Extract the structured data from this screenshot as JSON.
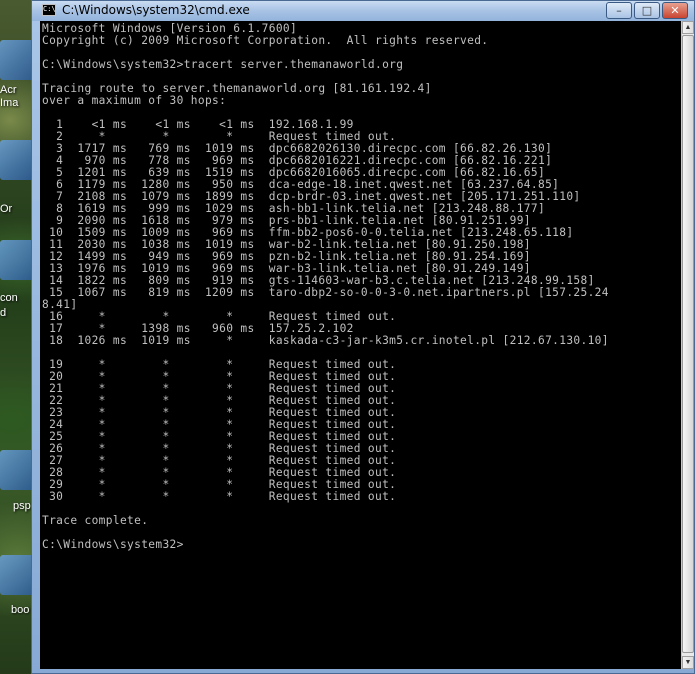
{
  "desktop": {
    "icon_labels": [
      "Acr",
      "Ima",
      "Or",
      "con",
      "d",
      "psp",
      "boo"
    ]
  },
  "window": {
    "title": "C:\\Windows\\system32\\cmd.exe",
    "icon_glyph": "C:\\",
    "buttons": {
      "minimize": "–",
      "maximize": "□",
      "close": "✕"
    }
  },
  "console": {
    "lines": [
      "Microsoft Windows [Version 6.1.7600]",
      "Copyright (c) 2009 Microsoft Corporation.  All rights reserved.",
      "",
      "C:\\Windows\\system32>tracert server.themanaworld.org",
      "",
      "Tracing route to server.themanaworld.org [81.161.192.4]",
      "over a maximum of 30 hops:",
      "",
      "  1    <1 ms    <1 ms    <1 ms  192.168.1.99",
      "  2     *        *        *     Request timed out.",
      "  3  1717 ms   769 ms  1019 ms  dpc6682026130.direcpc.com [66.82.26.130]",
      "  4   970 ms   778 ms   969 ms  dpc6682016221.direcpc.com [66.82.16.221]",
      "  5  1201 ms   639 ms  1519 ms  dpc6682016065.direcpc.com [66.82.16.65]",
      "  6  1179 ms  1280 ms   950 ms  dca-edge-18.inet.qwest.net [63.237.64.85]",
      "  7  2108 ms  1079 ms  1899 ms  dcp-brdr-03.inet.qwest.net [205.171.251.110]",
      "  8  1619 ms   999 ms  1029 ms  ash-bb1-link.telia.net [213.248.88.177]",
      "  9  2090 ms  1618 ms   979 ms  prs-bb1-link.telia.net [80.91.251.99]",
      " 10  1509 ms  1009 ms   969 ms  ffm-bb2-pos6-0-0.telia.net [213.248.65.118]",
      " 11  2030 ms  1038 ms  1019 ms  war-b2-link.telia.net [80.91.250.198]",
      " 12  1499 ms   949 ms   969 ms  pzn-b2-link.telia.net [80.91.254.169]",
      " 13  1976 ms  1019 ms   969 ms  war-b3-link.telia.net [80.91.249.149]",
      " 14  1822 ms   809 ms   919 ms  gts-114603-war-b3.c.telia.net [213.248.99.158]",
      " 15  1067 ms   819 ms  1209 ms  taro-dbp2-so-0-0-3-0.net.ipartners.pl [157.25.24",
      "8.41]",
      " 16     *        *        *     Request timed out.",
      " 17     *     1398 ms   960 ms  157.25.2.102",
      " 18  1026 ms  1019 ms     *     kaskada-c3-jar-k3m5.cr.inotel.pl [212.67.130.10]",
      "",
      " 19     *        *        *     Request timed out.",
      " 20     *        *        *     Request timed out.",
      " 21     *        *        *     Request timed out.",
      " 22     *        *        *     Request timed out.",
      " 23     *        *        *     Request timed out.",
      " 24     *        *        *     Request timed out.",
      " 25     *        *        *     Request timed out.",
      " 26     *        *        *     Request timed out.",
      " 27     *        *        *     Request timed out.",
      " 28     *        *        *     Request timed out.",
      " 29     *        *        *     Request timed out.",
      " 30     *        *        *     Request timed out.",
      "",
      "Trace complete.",
      "",
      "C:\\Windows\\system32>"
    ]
  }
}
